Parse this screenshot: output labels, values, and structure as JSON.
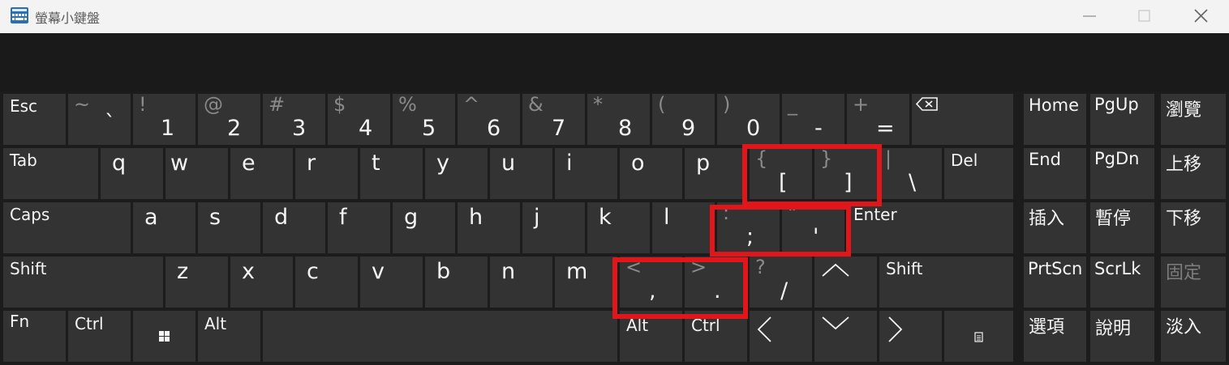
{
  "window": {
    "title": "螢幕小鍵盤",
    "controls": [
      "minimize",
      "maximize",
      "close"
    ]
  },
  "keys": {
    "esc": "Esc",
    "backtick": {
      "shift": "~",
      "main": "`"
    },
    "d1": {
      "shift": "!",
      "main": "1"
    },
    "d2": {
      "shift": "@",
      "main": "2"
    },
    "d3": {
      "shift": "#",
      "main": "3"
    },
    "d4": {
      "shift": "$",
      "main": "4"
    },
    "d5": {
      "shift": "%",
      "main": "5"
    },
    "d6": {
      "shift": "^",
      "main": "6"
    },
    "d7": {
      "shift": "&",
      "main": "7"
    },
    "d8": {
      "shift": "*",
      "main": "8"
    },
    "d9": {
      "shift": "(",
      "main": "9"
    },
    "d0": {
      "shift": ")",
      "main": "0"
    },
    "minus": {
      "shift": "_",
      "main": "-"
    },
    "equals": {
      "shift": "+",
      "main": "="
    },
    "tab": "Tab",
    "q": "q",
    "w": "w",
    "e": "e",
    "r": "r",
    "t": "t",
    "y": "y",
    "u": "u",
    "i": "i",
    "o": "o",
    "p": "p",
    "lbracket": {
      "shift": "{",
      "main": "["
    },
    "rbracket": {
      "shift": "}",
      "main": "]"
    },
    "backslash": {
      "shift": "|",
      "main": "\\"
    },
    "del": "Del",
    "caps": "Caps",
    "a": "a",
    "s": "s",
    "d": "d",
    "f": "f",
    "g": "g",
    "h": "h",
    "j": "j",
    "k": "k",
    "l": "l",
    "semicolon": {
      "shift": ":",
      "main": ";"
    },
    "quote": {
      "shift": "\"",
      "main": "'"
    },
    "enter": "Enter",
    "shift_left": "Shift",
    "z": "z",
    "x": "x",
    "c": "c",
    "v": "v",
    "b": "b",
    "n": "n",
    "m": "m",
    "comma": {
      "shift": "<",
      "main": ","
    },
    "period": {
      "shift": ">",
      "main": "."
    },
    "slash": {
      "shift": "?",
      "main": "/"
    },
    "shift_right": "Shift",
    "fn": "Fn",
    "ctrl_left": "Ctrl",
    "alt_left": "Alt",
    "alt_right": "Alt",
    "ctrl_right": "Ctrl",
    "home": "Home",
    "pgup": "PgUp",
    "browse": "瀏覽",
    "end": "End",
    "pgdn": "PgDn",
    "move_up": "上移",
    "insert": "插入",
    "pause": "暫停",
    "move_down": "下移",
    "prtscn": "PrtScn",
    "scrlk": "ScrLk",
    "dock": "固定",
    "options": "選項",
    "help": "說明",
    "fade": "淡入"
  },
  "colors": {
    "key_bg": "#333333",
    "board_bg": "#1c1c1c",
    "highlight": "#e0161b",
    "titlebar": "#f3f3f3"
  },
  "icons": [
    "keyboard-icon",
    "backspace-icon",
    "windows-icon",
    "up-arrow-icon",
    "down-arrow-icon",
    "left-arrow-icon",
    "right-arrow-icon",
    "context-menu-icon"
  ]
}
